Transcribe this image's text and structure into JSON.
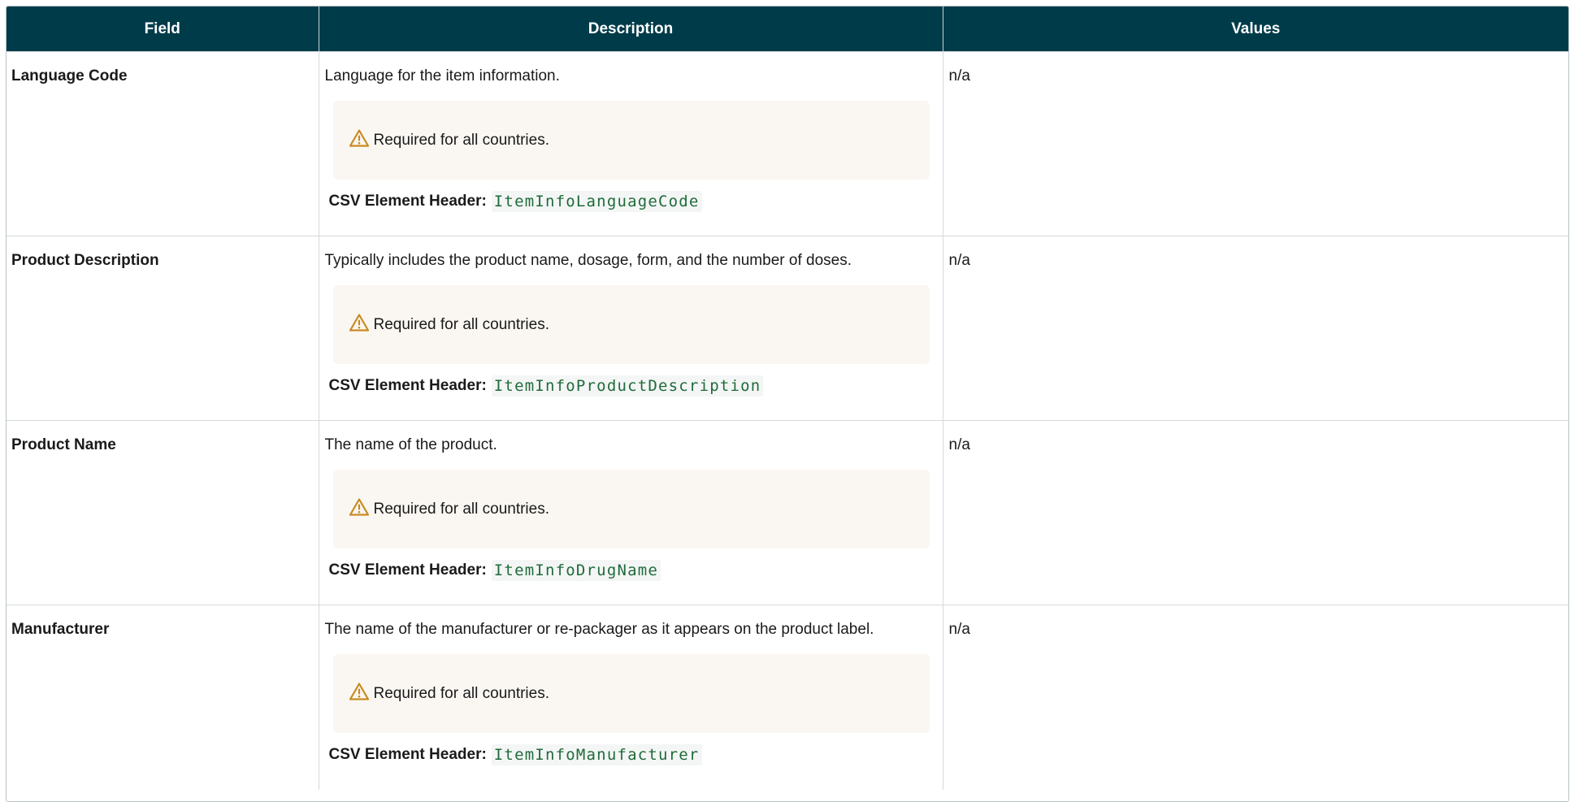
{
  "table": {
    "headers": {
      "field": "Field",
      "description": "Description",
      "values": "Values"
    },
    "csv_label": "CSV Element Header:",
    "rows": [
      {
        "field": "Language Code",
        "description": "Language for the item information.",
        "note": "Required for all countries.",
        "csv_header": "ItemInfoLanguageCode",
        "values": "n/a"
      },
      {
        "field": "Product Description",
        "description": "Typically includes the product name, dosage, form, and the number of doses.",
        "note": "Required for all countries.",
        "csv_header": "ItemInfoProductDescription",
        "values": "n/a"
      },
      {
        "field": "Product Name",
        "description": "The name of the product.",
        "note": "Required for all countries.",
        "csv_header": "ItemInfoDrugName",
        "values": "n/a"
      },
      {
        "field": "Manufacturer",
        "description": "The name of the manufacturer or re-packager as it appears on the product label.",
        "note": "Required for all countries.",
        "csv_header": "ItemInfoManufacturer",
        "values": "n/a"
      }
    ]
  },
  "colors": {
    "header_bg": "#003b4a",
    "warning": "#c98a22",
    "code_text": "#1f6b3a",
    "note_bg": "#faf7f2"
  },
  "icons": {
    "warning": "warning-triangle-icon"
  }
}
